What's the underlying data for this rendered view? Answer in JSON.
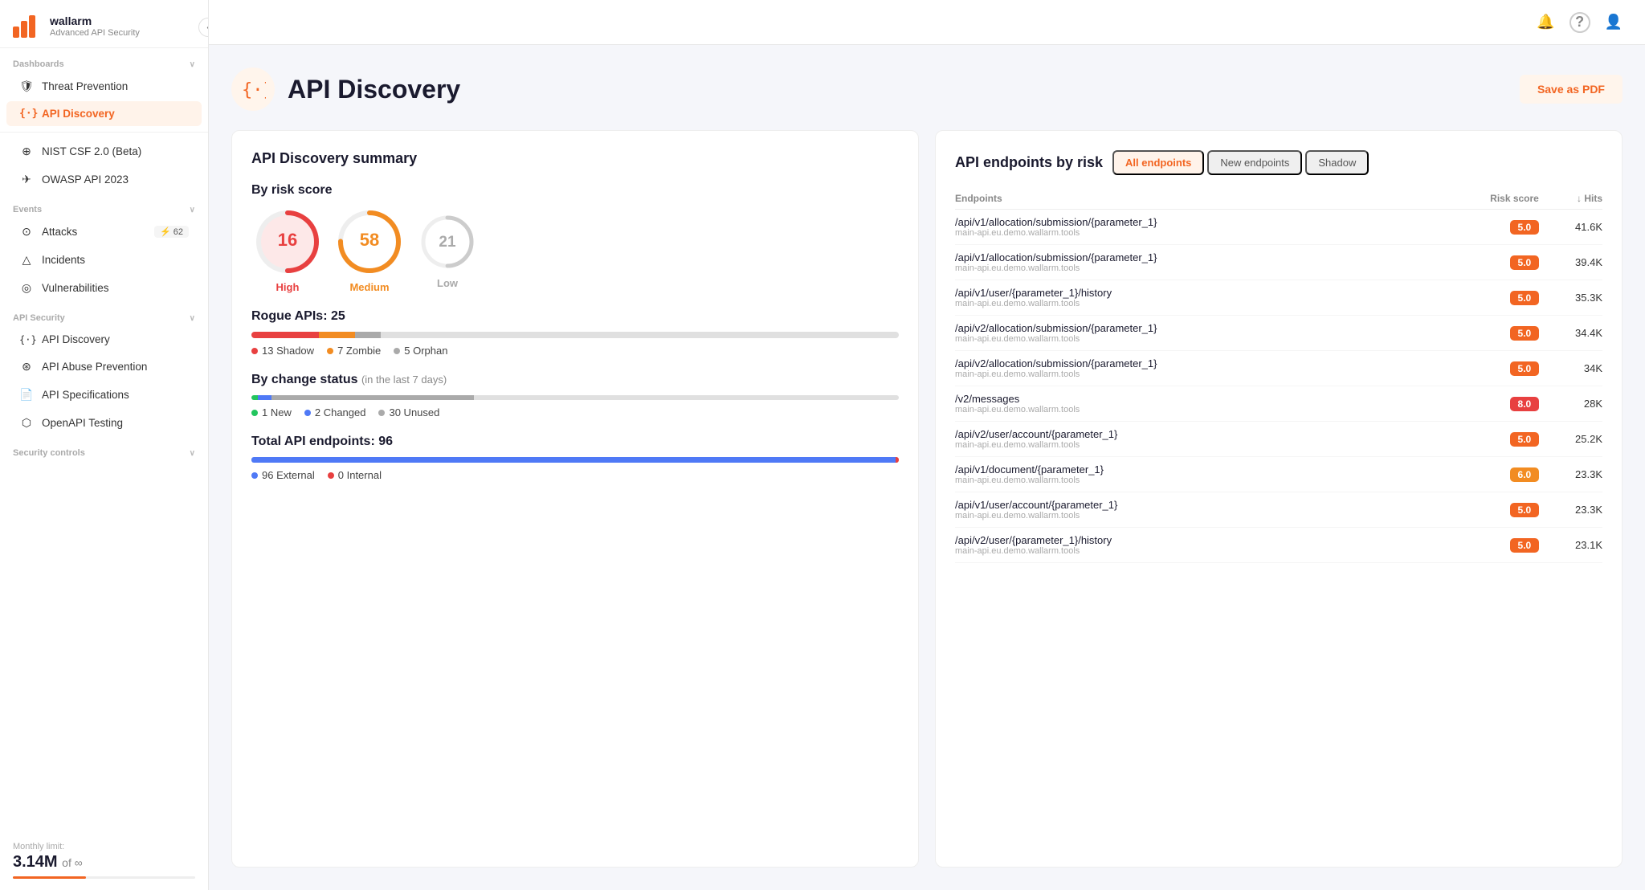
{
  "app": {
    "name": "wallarm",
    "subtitle": "Advanced API Security"
  },
  "topbar": {
    "bell_icon": "🔔",
    "help_icon": "?",
    "user_icon": "👤"
  },
  "sidebar": {
    "collapse_icon": "‹",
    "sections": [
      {
        "label": "Dashboards",
        "collapsible": true,
        "items": [
          {
            "id": "threat-prevention",
            "label": "Threat Prevention",
            "icon": "🛡"
          },
          {
            "id": "api-discovery",
            "label": "API Discovery",
            "icon": "{·}",
            "active": true
          }
        ]
      },
      {
        "label": "",
        "items": [
          {
            "id": "nist-csf",
            "label": "NIST CSF 2.0 (Beta)",
            "icon": "⊕"
          },
          {
            "id": "owasp-api",
            "label": "OWASP API 2023",
            "icon": "✈"
          }
        ]
      },
      {
        "label": "Events",
        "collapsible": true,
        "items": [
          {
            "id": "attacks",
            "label": "Attacks",
            "icon": "⊙",
            "badge": "62",
            "badge_icon": "⚡"
          },
          {
            "id": "incidents",
            "label": "Incidents",
            "icon": "△"
          },
          {
            "id": "vulnerabilities",
            "label": "Vulnerabilities",
            "icon": "◎"
          }
        ]
      },
      {
        "label": "API Security",
        "collapsible": true,
        "items": [
          {
            "id": "api-discovery-2",
            "label": "API Discovery",
            "icon": "{·}"
          },
          {
            "id": "api-abuse",
            "label": "API Abuse Prevention",
            "icon": "⊛"
          },
          {
            "id": "api-specs",
            "label": "API Specifications",
            "icon": "📄"
          },
          {
            "id": "openapi",
            "label": "OpenAPI Testing",
            "icon": "⬡"
          }
        ]
      },
      {
        "label": "Security controls",
        "collapsible": true,
        "items": []
      }
    ],
    "monthly_limit": {
      "label": "Monthly limit:",
      "value": "3.14M",
      "suffix": "of ∞"
    }
  },
  "page": {
    "icon": "{·}",
    "title": "API Discovery",
    "save_pdf_label": "Save as PDF"
  },
  "summary": {
    "title": "API Discovery summary",
    "risk_score": {
      "section_label": "By risk score",
      "high_value": "16",
      "high_label": "High",
      "medium_value": "58",
      "medium_label": "Medium",
      "low_value": "21",
      "low_label": "Low"
    },
    "rogue_apis": {
      "title": "Rogue APIs: 25",
      "shadow_count": 13,
      "zombie_count": 7,
      "orphan_count": 5,
      "shadow_label": "13 Shadow",
      "zombie_label": "7 Zombie",
      "orphan_label": "5 Orphan"
    },
    "change_status": {
      "title": "By change status",
      "subtitle": "(in the last 7 days)",
      "new_count": 1,
      "changed_count": 2,
      "unused_count": 30,
      "new_label": "1 New",
      "changed_label": "2 Changed",
      "unused_label": "30 Unused"
    },
    "total_endpoints": {
      "title": "Total API endpoints: 96",
      "external_count": 96,
      "internal_count": 0,
      "external_label": "96 External",
      "internal_label": "0 Internal"
    }
  },
  "endpoints_by_risk": {
    "title": "API endpoints by risk",
    "tabs": [
      {
        "id": "all",
        "label": "All endpoints",
        "active": true
      },
      {
        "id": "new",
        "label": "New endpoints"
      },
      {
        "id": "shadow",
        "label": "Shadow"
      }
    ],
    "columns": {
      "endpoints": "Endpoints",
      "risk_score": "Risk score",
      "hits": "↓ Hits"
    },
    "rows": [
      {
        "path": "/api/v1/allocation/submission/{parameter_1}",
        "domain": "main-api.eu.demo.wallarm.tools",
        "risk": "5.0",
        "risk_class": "risk-5",
        "hits": "41.6K"
      },
      {
        "path": "/api/v1/allocation/submission/{parameter_1}",
        "domain": "main-api.eu.demo.wallarm.tools",
        "risk": "5.0",
        "risk_class": "risk-5",
        "hits": "39.4K"
      },
      {
        "path": "/api/v1/user/{parameter_1}/history",
        "domain": "main-api.eu.demo.wallarm.tools",
        "risk": "5.0",
        "risk_class": "risk-5",
        "hits": "35.3K"
      },
      {
        "path": "/api/v2/allocation/submission/{parameter_1}",
        "domain": "main-api.eu.demo.wallarm.tools",
        "risk": "5.0",
        "risk_class": "risk-5",
        "hits": "34.4K"
      },
      {
        "path": "/api/v2/allocation/submission/{parameter_1}",
        "domain": "main-api.eu.demo.wallarm.tools",
        "risk": "5.0",
        "risk_class": "risk-5",
        "hits": "34K"
      },
      {
        "path": "/v2/messages",
        "domain": "main-api.eu.demo.wallarm.tools",
        "risk": "8.0",
        "risk_class": "risk-8",
        "hits": "28K"
      },
      {
        "path": "/api/v2/user/account/{parameter_1}",
        "domain": "main-api.eu.demo.wallarm.tools",
        "risk": "5.0",
        "risk_class": "risk-5",
        "hits": "25.2K"
      },
      {
        "path": "/api/v1/document/{parameter_1}",
        "domain": "main-api.eu.demo.wallarm.tools",
        "risk": "6.0",
        "risk_class": "risk-6",
        "hits": "23.3K"
      },
      {
        "path": "/api/v1/user/account/{parameter_1}",
        "domain": "main-api.eu.demo.wallarm.tools",
        "risk": "5.0",
        "risk_class": "risk-5",
        "hits": "23.3K"
      },
      {
        "path": "/api/v2/user/{parameter_1}/history",
        "domain": "main-api.eu.demo.wallarm.tools",
        "risk": "5.0",
        "risk_class": "risk-5",
        "hits": "23.1K"
      }
    ]
  }
}
